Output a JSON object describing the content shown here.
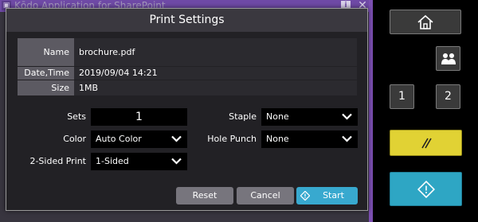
{
  "app": {
    "title": "Kōdo Application for SharePoint",
    "accent_color": "#6f4aa6"
  },
  "dialog": {
    "title": "Print Settings",
    "info": {
      "name_label": "Name",
      "name_value": "brochure.pdf",
      "datetime_label": "Date,Time",
      "datetime_value": "2019/09/04 14:21",
      "size_label": "Size",
      "size_value": "1MB"
    },
    "settings": {
      "sets_label": "Sets",
      "sets_value": "1",
      "color_label": "Color",
      "color_value": "Auto Color",
      "duplex_label": "2-Sided Print",
      "duplex_value": "1-Sided",
      "staple_label": "Staple",
      "staple_value": "None",
      "punch_label": "Hole Punch",
      "punch_value": "None"
    },
    "buttons": {
      "reset": "Reset",
      "cancel": "Cancel",
      "start": "Start",
      "start_color": "#38a9cf"
    }
  },
  "panel": {
    "one_label": "1",
    "two_label": "2",
    "stop_color": "#e1d234",
    "start_color": "#2ea6c4",
    "icons": [
      "home-icon",
      "user-icon",
      "stop-icon",
      "start-icon"
    ]
  }
}
